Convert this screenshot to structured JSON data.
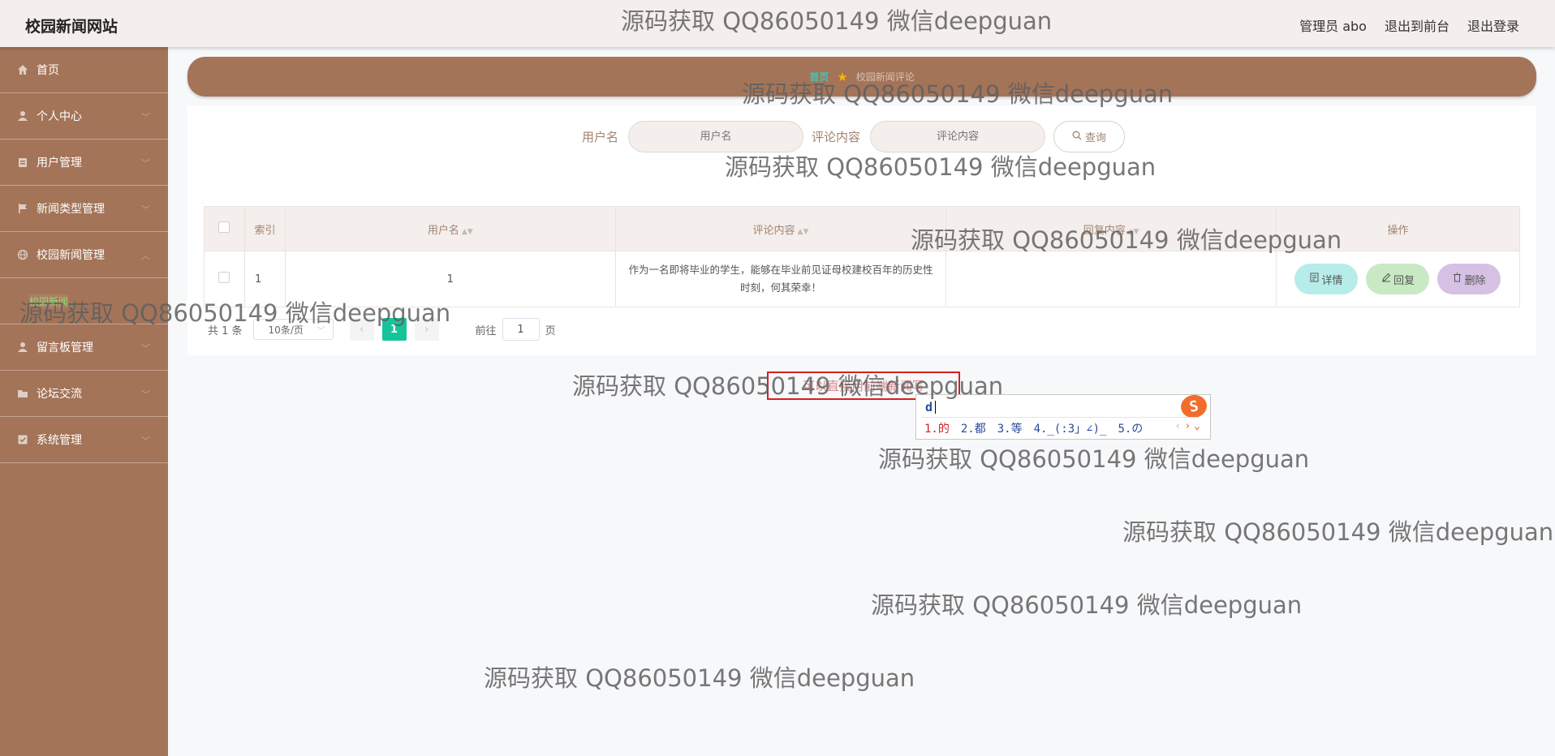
{
  "header": {
    "title": "校园新闻网站",
    "user_label": "管理员 abo",
    "front_link": "退出到前台",
    "logout_link": "退出登录"
  },
  "sidebar": {
    "items": [
      {
        "label": "首页",
        "icon": "home-icon"
      },
      {
        "label": "个人中心",
        "icon": "user-icon"
      },
      {
        "label": "用户管理",
        "icon": "users-icon"
      },
      {
        "label": "新闻类型管理",
        "icon": "flag-icon"
      },
      {
        "label": "校园新闻管理",
        "icon": "globe-icon"
      },
      {
        "label": "留言板管理",
        "icon": "user-icon"
      },
      {
        "label": "论坛交流",
        "icon": "folder-icon"
      },
      {
        "label": "系统管理",
        "icon": "checkbox-icon"
      }
    ],
    "sub_item": "校园新闻"
  },
  "breadcrumb": {
    "home": "首页",
    "current": "校园新闻评论"
  },
  "search": {
    "username_label": "用户名",
    "username_placeholder": "用户名",
    "comment_label": "评论内容",
    "comment_placeholder": "评论内容",
    "query_button": "查询"
  },
  "table": {
    "headers": {
      "index": "索引",
      "username": "用户名",
      "comment": "评论内容",
      "reply": "回复内容",
      "actions": "操作"
    },
    "rows": [
      {
        "index": "1",
        "username": "1",
        "comment": "作为一名即将毕业的学生，能够在毕业前见证母校建校百年的历史性时刻，何其荣幸！",
        "reply": ""
      }
    ],
    "action_labels": {
      "detail": "详情",
      "reply": "回复",
      "delete": "删除"
    }
  },
  "pagination": {
    "total_text": "共 1 条",
    "page_size": "10条/页",
    "current_page": "1",
    "goto_label": "前往",
    "goto_value": "1",
    "page_suffix": "页"
  },
  "overlay_box_text": "可以直接用前端新闻写",
  "ime": {
    "composition": "d",
    "candidates": [
      "1.的",
      "2.都",
      "3.等",
      "4._(:3」∠)_",
      "5.の"
    ]
  },
  "watermark": "源码获取 QQ86050149 微信deepguan",
  "colors": {
    "sidebar": "#a47458",
    "topbar": "#f4eeec",
    "accent": "#16c49b",
    "detail_button": "#b6ece9",
    "reply_button": "#c8e9c4",
    "delete_button": "#d6c1e4"
  }
}
